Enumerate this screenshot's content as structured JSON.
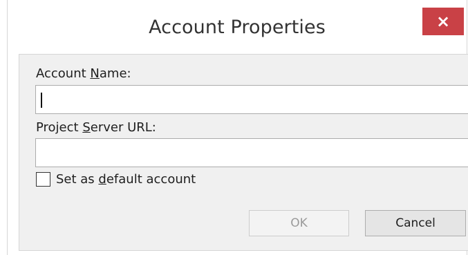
{
  "window": {
    "title": "Account Properties",
    "close_glyph": "×",
    "close_icon": "close-icon",
    "close_color": "#c94146"
  },
  "form": {
    "account_name_label_pre": "Account ",
    "account_name_label_accel": "N",
    "account_name_label_post": "ame:",
    "account_name_value": "",
    "server_url_label_pre": "Project ",
    "server_url_label_accel": "S",
    "server_url_label_post": "erver URL:",
    "server_url_value": "",
    "default_checkbox_label_pre": "Set as ",
    "default_checkbox_label_accel": "d",
    "default_checkbox_label_post": "efault account",
    "default_checkbox_checked": false
  },
  "buttons": {
    "ok_label": "OK",
    "ok_enabled": false,
    "cancel_label": "Cancel"
  }
}
